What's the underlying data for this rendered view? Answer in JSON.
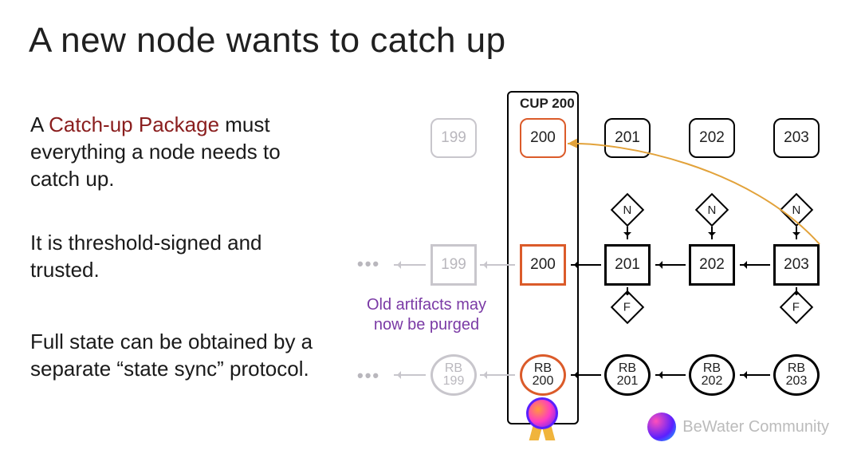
{
  "title": "A new node wants to catch up",
  "para1_pre": "A ",
  "para1_highlight": "Catch-up Package",
  "para1_post": " must everything a node needs to catch up.",
  "para2": "It is threshold-signed and trusted.",
  "para3": "Full state can be obtained by a separate “state sync” protocol.",
  "caption": "Old artifacts may now be purged",
  "cup_label": "CUP 200",
  "row1": {
    "c0": "199",
    "c1": "200",
    "c2": "201",
    "c3": "202",
    "c4": "203"
  },
  "row2": {
    "c0": "199",
    "c1": "200",
    "c2": "201",
    "c3": "202",
    "c4": "203"
  },
  "row3_label": "RB",
  "row3": {
    "c0": "199",
    "c1": "200",
    "c2": "201",
    "c3": "202",
    "c4": "203"
  },
  "letters": {
    "N": "N",
    "F": "F"
  },
  "ellipsis": "•••",
  "watermark": "BeWater Community"
}
